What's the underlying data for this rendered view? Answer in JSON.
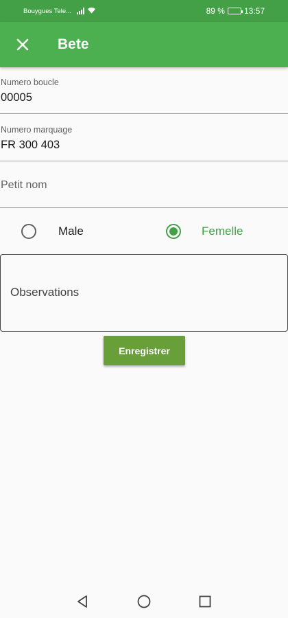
{
  "status_bar": {
    "carrier": "Bouygues Tele...",
    "battery_text": "89 %",
    "battery_level": 0.89,
    "time": "13:57"
  },
  "app_bar": {
    "title": "Bete",
    "close_icon": "close-icon"
  },
  "form": {
    "numero_boucle": {
      "label": "Numero boucle",
      "value": "00005"
    },
    "numero_marquage": {
      "label": "Numero marquage",
      "value": "FR 300 403"
    },
    "petit_nom": {
      "placeholder": "Petit nom"
    },
    "sex": {
      "options": [
        {
          "label": "Male",
          "selected": false
        },
        {
          "label": "Femelle",
          "selected": true
        }
      ]
    },
    "observations": {
      "placeholder": "Observations"
    },
    "save_label": "Enregistrer"
  },
  "colors": {
    "app_bar": "#4caf50",
    "status_bar": "#43a047",
    "accent": "#43a047",
    "button": "#689f38"
  },
  "nav_bar": {
    "icons": [
      "back-icon",
      "home-icon",
      "recents-icon"
    ]
  }
}
